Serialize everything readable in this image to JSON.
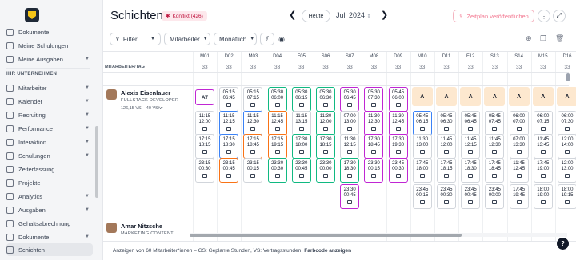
{
  "sidebar": {
    "items_top": [
      {
        "label": "Dokumente"
      },
      {
        "label": "Meine Schulungen"
      },
      {
        "label": "Meine Ausgaben"
      }
    ],
    "section_title": "IHR UNTERNEHMEN",
    "items": [
      {
        "label": "Mitarbeiter"
      },
      {
        "label": "Kalender"
      },
      {
        "label": "Recruiting"
      },
      {
        "label": "Performance"
      },
      {
        "label": "Interaktion"
      },
      {
        "label": "Schulungen"
      },
      {
        "label": "Zeiterfassung"
      },
      {
        "label": "Projekte"
      },
      {
        "label": "Analytics"
      },
      {
        "label": "Ausgaben"
      },
      {
        "label": "Gehaltsabrechnung"
      },
      {
        "label": "Dokumente"
      },
      {
        "label": "Schichten"
      }
    ]
  },
  "header": {
    "title": "Schichten",
    "conflict_badge": "Konflikt (426)",
    "today": "Heute",
    "month": "Juli 2024",
    "publish": "Zeitplan veröffentlichen"
  },
  "toolbar": {
    "filter": "Filter",
    "employees": "Mitarbeiter",
    "view": "Monatlich"
  },
  "grid": {
    "employee_header": "MITARBEITER/TAG",
    "days": [
      "M01",
      "D02",
      "M03",
      "D04",
      "F05",
      "S06",
      "S07",
      "M08",
      "D09",
      "M10",
      "D11",
      "F12",
      "S13",
      "S14",
      "M15",
      "D16"
    ],
    "counts": [
      "33",
      "33",
      "33",
      "33",
      "33",
      "33",
      "33",
      "33",
      "33",
      "33",
      "33",
      "33",
      "33",
      "33",
      "33",
      "33"
    ],
    "employees": [
      {
        "name": "Alexis Eisenlauer",
        "role": "FULLSTACK DEVELOPER",
        "hours": "126,15 VS – 40 VS/w"
      },
      {
        "name": "Amar Nitzsche",
        "role": "MARKETING CONTENT"
      }
    ],
    "at_label": "AT",
    "absent_label": "A",
    "shifts": [
      {
        "col": 0,
        "row": 1,
        "time": "11:15\n12:00",
        "color": "#d1d5db"
      },
      {
        "col": 0,
        "row": 2,
        "time": "17:15\n18:15",
        "color": "#d1d5db"
      },
      {
        "col": 0,
        "row": 3,
        "time": "23:15\n00:30",
        "color": "#d1d5db"
      },
      {
        "col": 1,
        "row": 0,
        "time": "05:15\n06:45",
        "color": "#d1d5db"
      },
      {
        "col": 1,
        "row": 1,
        "time": "11:15\n12:15",
        "color": "#3b82f6"
      },
      {
        "col": 1,
        "row": 2,
        "time": "17:15\n18:30",
        "color": "#3b82f6"
      },
      {
        "col": 1,
        "row": 3,
        "time": "23:15\n00:45",
        "color": "#f97316"
      },
      {
        "col": 2,
        "row": 0,
        "time": "05:15\n07:15",
        "color": "#d1d5db"
      },
      {
        "col": 2,
        "row": 1,
        "time": "11:15\n12:30",
        "color": "#3b82f6"
      },
      {
        "col": 2,
        "row": 2,
        "time": "17:15\n18:45",
        "color": "#f97316"
      },
      {
        "col": 2,
        "row": 3,
        "time": "23:15\n00:15",
        "color": "#d1d5db"
      },
      {
        "col": 3,
        "row": 0,
        "time": "05:30\n06:00",
        "color": "#10b981"
      },
      {
        "col": 3,
        "row": 1,
        "time": "11:15\n12:45",
        "color": "#f97316"
      },
      {
        "col": 3,
        "row": 2,
        "time": "17:15\n19:15",
        "color": "#f97316"
      },
      {
        "col": 3,
        "row": 3,
        "time": "23:30\n00:30",
        "color": "#10b981"
      },
      {
        "col": 4,
        "row": 0,
        "time": "05:30\n06:15",
        "color": "#10b981"
      },
      {
        "col": 4,
        "row": 1,
        "time": "11:15\n13:15",
        "color": "#d1d5db"
      },
      {
        "col": 4,
        "row": 2,
        "time": "17:30\n18:00",
        "color": "#10b981"
      },
      {
        "col": 4,
        "row": 3,
        "time": "23:30\n00:45",
        "color": "#10b981"
      },
      {
        "col": 5,
        "row": 0,
        "time": "05:30\n06:30",
        "color": "#10b981"
      },
      {
        "col": 5,
        "row": 1,
        "time": "11:30\n12:00",
        "color": "#10b981"
      },
      {
        "col": 5,
        "row": 2,
        "time": "17:30\n18:15",
        "color": "#10b981"
      },
      {
        "col": 5,
        "row": 3,
        "time": "23:30\n00:00",
        "color": "#10b981"
      },
      {
        "col": 6,
        "row": 0,
        "time": "05:30\n06:45",
        "color": "#c026d3"
      },
      {
        "col": 6,
        "row": 1,
        "time": "07:00\n13:00",
        "color": "#d1d5db"
      },
      {
        "col": 6,
        "row": 2,
        "time": "11:30\n12:15",
        "color": "#d1d5db"
      },
      {
        "col": 6,
        "row": 3,
        "time": "17:30\n18:30",
        "color": "#10b981"
      },
      {
        "col": 6,
        "row": 4,
        "time": "23:30\n00:45",
        "color": "#c026d3"
      },
      {
        "col": 7,
        "row": 0,
        "time": "05:30\n07:30",
        "color": "#c026d3"
      },
      {
        "col": 7,
        "row": 1,
        "time": "11:30\n12:30",
        "color": "#c026d3"
      },
      {
        "col": 7,
        "row": 2,
        "time": "17:30\n18:45",
        "color": "#c026d3"
      },
      {
        "col": 7,
        "row": 3,
        "time": "23:30\n00:15",
        "color": "#c026d3"
      },
      {
        "col": 8,
        "row": 0,
        "time": "05:45\n06:00",
        "color": "#c026d3"
      },
      {
        "col": 8,
        "row": 1,
        "time": "11:30\n12:45",
        "color": "#c026d3"
      },
      {
        "col": 8,
        "row": 2,
        "time": "17:30\n19:30",
        "color": "#c026d3"
      },
      {
        "col": 8,
        "row": 3,
        "time": "23:45\n00:30",
        "color": "#c026d3"
      },
      {
        "col": 9,
        "row": 1,
        "time": "05:45\n06:15",
        "color": "#3b82f6"
      },
      {
        "col": 9,
        "row": 2,
        "time": "11:30\n13:00",
        "color": "#d1d5db"
      },
      {
        "col": 9,
        "row": 3,
        "time": "17:45\n18:00",
        "color": "#d1d5db"
      },
      {
        "col": 9,
        "row": 4,
        "time": "23:45\n00:15",
        "color": "#d1d5db"
      },
      {
        "col": 10,
        "row": 1,
        "time": "05:45\n06:30",
        "color": "#d1d5db"
      },
      {
        "col": 10,
        "row": 2,
        "time": "11:45\n12:00",
        "color": "#d1d5db"
      },
      {
        "col": 10,
        "row": 3,
        "time": "17:45\n18:15",
        "color": "#d1d5db"
      },
      {
        "col": 10,
        "row": 4,
        "time": "23:45\n00:30",
        "color": "#d1d5db"
      },
      {
        "col": 11,
        "row": 1,
        "time": "05:45\n06:45",
        "color": "#d1d5db"
      },
      {
        "col": 11,
        "row": 2,
        "time": "11:45\n12:15",
        "color": "#d1d5db"
      },
      {
        "col": 11,
        "row": 3,
        "time": "17:45\n18:30",
        "color": "#d1d5db"
      },
      {
        "col": 11,
        "row": 4,
        "time": "23:45\n00:45",
        "color": "#d1d5db"
      },
      {
        "col": 12,
        "row": 1,
        "time": "05:45\n07:45",
        "color": "#d1d5db"
      },
      {
        "col": 12,
        "row": 2,
        "time": "11:45\n12:30",
        "color": "#d1d5db"
      },
      {
        "col": 12,
        "row": 3,
        "time": "17:45\n18:45",
        "color": "#d1d5db"
      },
      {
        "col": 12,
        "row": 4,
        "time": "23:45\n00:00",
        "color": "#d1d5db"
      },
      {
        "col": 13,
        "row": 1,
        "time": "06:00\n07:00",
        "color": "#d1d5db"
      },
      {
        "col": 13,
        "row": 2,
        "time": "07:00\n13:30",
        "color": "#d1d5db"
      },
      {
        "col": 13,
        "row": 3,
        "time": "11:45\n12:45",
        "color": "#d1d5db"
      },
      {
        "col": 13,
        "row": 4,
        "time": "17:45\n19:45",
        "color": "#d1d5db"
      },
      {
        "col": 14,
        "row": 1,
        "time": "06:00\n07:15",
        "color": "#d1d5db"
      },
      {
        "col": 14,
        "row": 2,
        "time": "11:45\n13:45",
        "color": "#d1d5db"
      },
      {
        "col": 14,
        "row": 3,
        "time": "17:45\n19:00",
        "color": "#d1d5db"
      },
      {
        "col": 14,
        "row": 4,
        "time": "18:00\n19:00",
        "color": "#d1d5db"
      },
      {
        "col": 15,
        "row": 1,
        "time": "06:00\n07:30",
        "color": "#d1d5db"
      },
      {
        "col": 15,
        "row": 2,
        "time": "12:00\n14:00",
        "color": "#d1d5db"
      },
      {
        "col": 15,
        "row": 3,
        "time": "12:00\n13:00",
        "color": "#d1d5db"
      },
      {
        "col": 15,
        "row": 4,
        "time": "18:00\n19:15",
        "color": "#d1d5db"
      }
    ]
  },
  "footer": {
    "text": "Anzeigen von 60 Mitarbeiter*innen – GS: Geplante Stunden, VS: Vertragsstunden",
    "link": "Farbcode anzeigen"
  },
  "colors": {
    "conflict": "#be123c",
    "publish": "#f37891",
    "absent_bg": "#fde8cf"
  }
}
